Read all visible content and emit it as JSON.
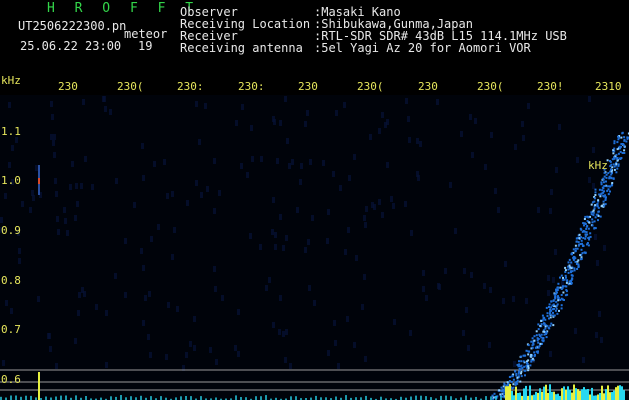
{
  "header": {
    "title": "H R O F F T",
    "filename": "UT2506222300.pn",
    "tag": "meteor",
    "datetime": "25.06.22 23:00",
    "count": "19",
    "fields": [
      {
        "label": "Observer",
        "value": ":Masaki Kano"
      },
      {
        "label": "Receiving Location",
        "value": ":Shibukawa,Gunma,Japan"
      },
      {
        "label": "Receiver",
        "value": ":RTL-SDR SDR# 43dB L15 114.1MHz USB"
      },
      {
        "label": "Receiving antenna",
        "value": ":5el Yagi Az 20 for Aomori VOR"
      }
    ]
  },
  "axis": {
    "y_unit": "kHz",
    "y_unit_inline": "kHz",
    "y_ticks": [
      "1.1",
      "1.0",
      "0.9",
      "0.8",
      "0.7",
      "0.6"
    ],
    "x_ticks": [
      "230",
      "230(",
      "230:",
      "230:",
      "230",
      "230(",
      "230",
      "230(",
      "230!",
      "2310"
    ]
  },
  "colors": {
    "background": "#000000",
    "grid": "#0a1a3a",
    "trace": "#1e6fd8",
    "trace_bright": "#8fd0ff",
    "noise_band": "#e6f040",
    "cyan_band": "#28d8f0"
  }
}
